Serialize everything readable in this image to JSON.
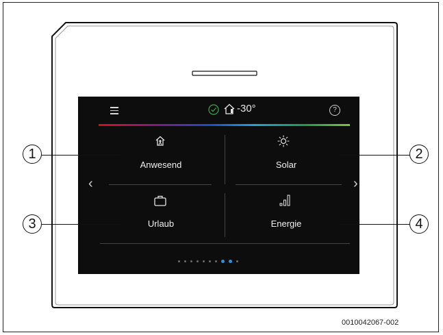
{
  "screen": {
    "status": {
      "temperature": "-30°",
      "help_label": "?"
    },
    "tiles": [
      {
        "label": "Anwesend",
        "icon": "home-present-icon"
      },
      {
        "label": "Solar",
        "icon": "sun-icon"
      },
      {
        "label": "Urlaub",
        "icon": "suitcase-icon"
      },
      {
        "label": "Energie",
        "icon": "energy-bars-icon"
      }
    ],
    "nav": {
      "prev": "‹",
      "next": "›"
    },
    "page_dots": {
      "count": 10,
      "active": [
        7,
        8
      ]
    }
  },
  "callouts": [
    "1",
    "2",
    "3",
    "4"
  ],
  "figure_id": "0010042067-002",
  "colors": {
    "screen_bg": "#0d0d0d",
    "active_dot": "#2e8fe0"
  }
}
